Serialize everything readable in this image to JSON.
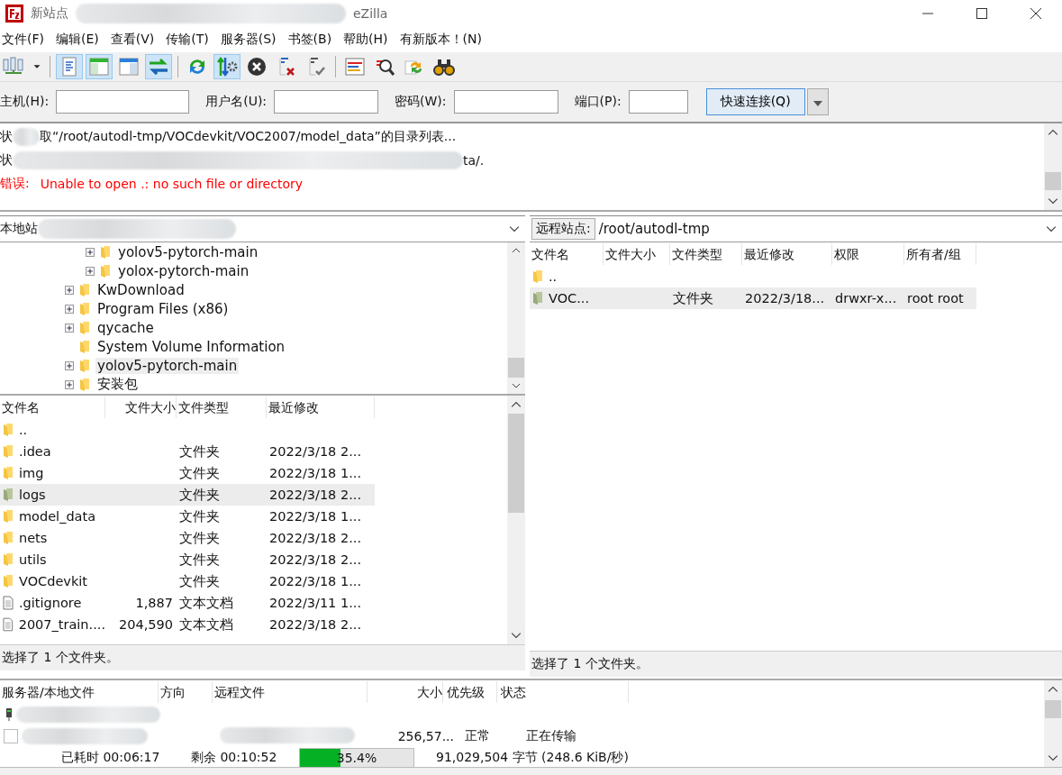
{
  "window": {
    "title_parts": [
      "新站点",
      "eZilla"
    ]
  },
  "menu": [
    "文件(F)",
    "编辑(E)",
    "查看(V)",
    "传输(T)",
    "服务器(S)",
    "书签(B)",
    "帮助(H)",
    "有新版本！(N)"
  ],
  "toolbar": [
    {
      "kind": "sitemanager"
    },
    {
      "kind": "dropdown"
    },
    {
      "kind": "sep"
    },
    {
      "kind": "messagelog",
      "on": true
    },
    {
      "kind": "localtree",
      "on": true
    },
    {
      "kind": "remotetree",
      "on": false
    },
    {
      "kind": "queue",
      "on": true
    },
    {
      "kind": "sep"
    },
    {
      "kind": "refresh"
    },
    {
      "kind": "processqueue",
      "on": true
    },
    {
      "kind": "cancel"
    },
    {
      "kind": "disconnect"
    },
    {
      "kind": "reconnect"
    },
    {
      "kind": "sep"
    },
    {
      "kind": "filter"
    },
    {
      "kind": "compare"
    },
    {
      "kind": "sync"
    },
    {
      "kind": "search"
    }
  ],
  "quickconnect": {
    "fields": [
      {
        "label": "主机(H):",
        "kind": "host"
      },
      {
        "label": "用户名(U):",
        "kind": "user"
      },
      {
        "label": "密码(W):",
        "kind": "password"
      },
      {
        "label": "端口(P):",
        "kind": "port"
      }
    ],
    "button": "快速连接(Q)"
  },
  "log": [
    {
      "kind": "status",
      "prefix": "状",
      "text": "取“/root/autodl-tmp/VOCdevkit/VOC2007/model_data”的目录列表..."
    },
    {
      "kind": "status",
      "prefix": "状",
      "text": "ta/."
    },
    {
      "kind": "error",
      "prefix": "错误:",
      "text": "Unable to open .: no such file or directory"
    }
  ],
  "local": {
    "label": "本地站",
    "tree": [
      {
        "children": [
          {
            "label": "yolov5-pytorch-main",
            "expandable": true,
            "selected": false
          },
          {
            "label": "yolox-pytorch-main",
            "expandable": true,
            "selected": false
          }
        ]
      },
      {
        "label": "KwDownload",
        "expandable": true,
        "selected": false
      },
      {
        "label": "Program Files (x86)",
        "expandable": true,
        "selected": false
      },
      {
        "label": "qycache",
        "expandable": true,
        "selected": false
      },
      {
        "label": "System Volume Information",
        "expandable": false,
        "selected": false
      },
      {
        "label": "yolov5-pytorch-main",
        "expandable": true,
        "selected": true
      },
      {
        "label": "安装包",
        "expandable": true,
        "selected": false
      }
    ],
    "columns": [
      "文件名",
      "文件大小",
      "文件类型",
      "最近修改"
    ],
    "rows": [
      {
        "kind": "folder",
        "name": "..",
        "selected": false
      },
      {
        "kind": "folder",
        "name": ".idea",
        "type": "文件夹",
        "modified": "2022/3/18 2...",
        "selected": false
      },
      {
        "kind": "folder",
        "name": "img",
        "type": "文件夹",
        "modified": "2022/3/18 1...",
        "selected": false
      },
      {
        "kind": "folder",
        "name": "logs",
        "type": "文件夹",
        "modified": "2022/3/18 2...",
        "selected": true
      },
      {
        "kind": "folder",
        "name": "model_data",
        "type": "文件夹",
        "modified": "2022/3/18 1...",
        "selected": false
      },
      {
        "kind": "folder",
        "name": "nets",
        "type": "文件夹",
        "modified": "2022/3/18 2...",
        "selected": false
      },
      {
        "kind": "folder",
        "name": "utils",
        "type": "文件夹",
        "modified": "2022/3/18 2...",
        "selected": false
      },
      {
        "kind": "folder",
        "name": "VOCdevkit",
        "type": "文件夹",
        "modified": "2022/3/18 1...",
        "selected": false
      },
      {
        "kind": "file",
        "name": ".gitignore",
        "size": "1,887",
        "type": "文本文档",
        "modified": "2022/3/11 1...",
        "selected": false
      },
      {
        "kind": "file",
        "name": "2007_train....",
        "size": "204,590",
        "type": "文本文档",
        "modified": "2022/3/18 2...",
        "selected": false
      }
    ],
    "status": "选择了 1 个文件夹。"
  },
  "remote": {
    "label": "远程站点:",
    "path": "/root/autodl-tmp",
    "columns": [
      "文件名",
      "文件大小",
      "文件类型",
      "最近修改",
      "权限",
      "所有者/组"
    ],
    "rows": [
      {
        "name": "..",
        "selected": false
      },
      {
        "name": "VOC...",
        "type": "文件夹",
        "modified": "2022/3/18...",
        "permissions": "drwxr-x...",
        "owner": "root root",
        "selected": true
      }
    ],
    "status": "选择了 1 个文件夹。"
  },
  "queue": {
    "columns": [
      "服务器/本地文件",
      "方向",
      "远程文件",
      "大小",
      "优先级",
      "状态"
    ],
    "rows": [
      {
        "kind": "server"
      },
      {
        "kind": "file",
        "size": "256,57...",
        "priority": "正常",
        "status": "正在传输"
      }
    ],
    "progress": {
      "elapsed": "已耗时 00:06:17",
      "remaining": "剩余 00:10:52",
      "level": 0.354,
      "percent": "35.4%",
      "bytes": "91,029,504 字节 (248.6 KiB/秒)"
    }
  }
}
